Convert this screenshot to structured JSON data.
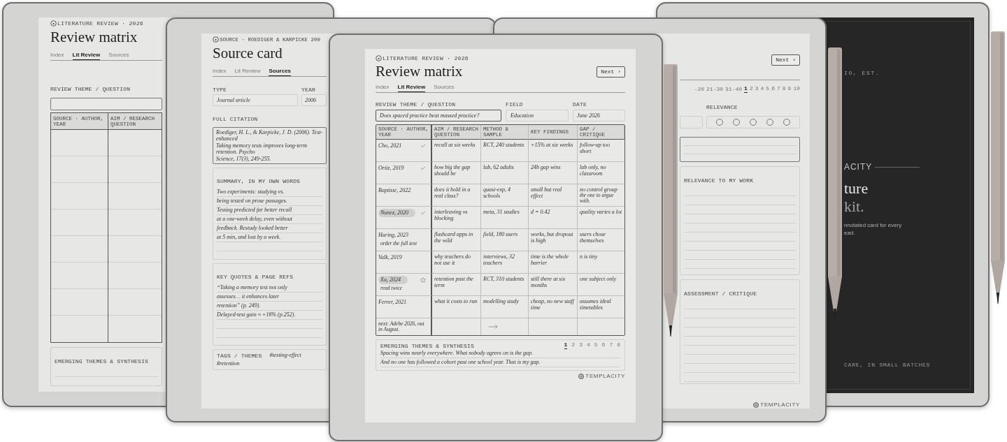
{
  "tablets": [
    {
      "kind": "matrix_outline",
      "eyebrow": "LITERATURE REVIEW · 2026",
      "title": "Review matrix",
      "tabs": [
        {
          "label": "Index",
          "selected": false
        },
        {
          "label": "Lit Review",
          "selected": true
        },
        {
          "label": "Sources",
          "selected": false
        }
      ],
      "theme_label": "REVIEW THEME / QUESTION",
      "columns": [
        "SOURCE · AUTHOR, YEAR",
        "AIM / RESEARCH QUESTION"
      ],
      "synthesis_label": "EMERGING THEMES & SYNTHESIS"
    },
    {
      "kind": "source_card",
      "eyebrow": "SOURCE · ROEDIGER & KARPICKE 200",
      "title": "Source card",
      "tabs": [
        {
          "label": "Index",
          "selected": false
        },
        {
          "label": "Lit Review",
          "selected": false
        },
        {
          "label": "Sources",
          "selected": true
        }
      ],
      "type_label": "TYPE",
      "type_value": "Journal article",
      "year_label": "YEAR",
      "year_value": "2006",
      "citation_label": "FULL CITATION",
      "citation_lines": [
        "Roediger, H. L., & Karpicke, J. D. (2006). Test-enhanced",
        "Taking memory tests improves long-term retention. Psycho",
        "Science, 17(3), 249-255."
      ],
      "summary_label": "SUMMARY, IN MY OWN WORDS",
      "summary_lines": [
        "Two experiments: studying vs.",
        "being tested on prose passages.",
        "Testing predicted far better recall",
        "at a one-week delay, even without",
        "feedback. Restudy looked better",
        "at 5 min, and lost by a week."
      ],
      "quotes_label": "KEY QUOTES & PAGE REFS",
      "quotes_lines": [
        "“Taking a memory test not only",
        "assesses… it enhances later",
        "retention” (p. 249).",
        "Delayed-test gain ≈ +18% (p.252)."
      ],
      "tags_label": "TAGS / THEMES",
      "tags": [
        "#testing-effect",
        "#retention"
      ]
    },
    {
      "kind": "matrix_filled",
      "eyebrow": "LITERATURE REVIEW · 2026",
      "title": "Review matrix",
      "next": "Next ›",
      "tabs": [
        {
          "label": "Index",
          "selected": false
        },
        {
          "label": "Lit Review",
          "selected": true
        },
        {
          "label": "Sources",
          "selected": false
        }
      ],
      "theme_label": "REVIEW THEME / QUESTION",
      "theme_value": "Does spaced practice beat massed practice?",
      "field_label": "FIELD",
      "field_value": "Education",
      "date_label": "DATE",
      "date_value": "June 2026",
      "columns": [
        "SOURCE · AUTHOR, YEAR",
        "AIM / RESEARCH QUESTION",
        "METHOD & SAMPLE",
        "KEY FINDINGS",
        "GAP / CRITIQUE"
      ],
      "rows": [
        {
          "source": "Cho, 2021",
          "highlighted": false,
          "checked": true,
          "starred": false,
          "aim": "recall at six weeks",
          "method": "RCT, 240 students",
          "findings": "+15% at six weeks",
          "gap": "follow-up too short"
        },
        {
          "source": "Ortiz, 2019",
          "highlighted": false,
          "checked": true,
          "starred": false,
          "aim": "how big the gap should be",
          "method": "lab, 62 adults",
          "findings": "24h gap wins",
          "gap": "lab only, no classroom"
        },
        {
          "source": "Baptiste, 2022",
          "highlighted": false,
          "checked": false,
          "starred": false,
          "aim": "does it hold in a real class?",
          "method": "quasi-exp, 4 schools",
          "findings": "small but real effect",
          "gap": "no control group",
          "gap_note": "the one to argue with."
        },
        {
          "source": "Nunez, 2020",
          "highlighted": true,
          "checked": true,
          "starred": false,
          "aim": "interleaving vs blocking",
          "method": "meta, 31 studies",
          "findings": "d = 0.42",
          "gap": "quality varies a lot"
        },
        {
          "source": "Haring, 2023",
          "note": "order the full text",
          "highlighted": false,
          "checked": false,
          "starred": false,
          "aim": "flashcard apps in the wild",
          "method": "field, 180 users",
          "findings": "works, but dropout is high",
          "gap": "users chose themselves"
        },
        {
          "source": "Valk, 2019",
          "highlighted": false,
          "checked": false,
          "starred": false,
          "aim": "why teachers do not use it",
          "method": "interviews, 32 teachers",
          "findings": "time is the whole barrier",
          "gap": "n is tiny"
        },
        {
          "source": "Xu, 2024",
          "note": "read twice",
          "highlighted": true,
          "checked": false,
          "starred": true,
          "aim": "retention past the term",
          "method": "RCT, 310 students",
          "findings": "still there at six months",
          "gap": "one subject only"
        },
        {
          "source": "Ferrer, 2021",
          "highlighted": false,
          "checked": false,
          "starred": false,
          "aim": "what it costs to run",
          "method": "modelling study",
          "findings": "cheap, no new staff time",
          "gap": "assumes ideal timetables"
        }
      ],
      "table_note": "next: Adebe 2026, out in August.",
      "synthesis_label": "EMERGING THEMES & SYNTHESIS",
      "pages": [
        {
          "label": "1",
          "selected": true
        },
        {
          "label": "2",
          "selected": false
        },
        {
          "label": "3",
          "selected": false
        },
        {
          "label": "4",
          "selected": false
        },
        {
          "label": "5",
          "selected": false
        },
        {
          "label": "6",
          "selected": false
        },
        {
          "label": "7",
          "selected": false
        },
        {
          "label": "8",
          "selected": false
        }
      ],
      "synthesis_lines": [
        "Spacing wins nearly everywhere. What nobody agrees on is the gap.",
        "And no one has followed a cohort past one school year. That is my gap."
      ],
      "brand": "TEMPLACITY"
    },
    {
      "kind": "source_detail",
      "next": "Next ›",
      "ranges": [
        "-20",
        "21-30",
        "31-40"
      ],
      "pages": [
        {
          "label": "1",
          "selected": true
        },
        {
          "label": "2",
          "selected": false
        },
        {
          "label": "3",
          "selected": false
        },
        {
          "label": "4",
          "selected": false
        },
        {
          "label": "5",
          "selected": false
        },
        {
          "label": "6",
          "selected": false
        },
        {
          "label": "7",
          "selected": false
        },
        {
          "label": "8",
          "selected": false
        },
        {
          "label": "9",
          "selected": false
        },
        {
          "label": "10",
          "selected": false
        }
      ],
      "relevance_label": "RELEVANCE",
      "stars": 0,
      "relevance_section": "RELEVANCE TO MY WORK",
      "assessment_section": "ASSESSMENT / CRITIQUE",
      "brand": "TEMPLACITY"
    },
    {
      "kind": "cover",
      "eyebrow": "IO, EST.",
      "brand": "ACITY",
      "title_lines": [
        "ture",
        "kit."
      ],
      "blurb_lines": [
        "nnotated card for every",
        "ead."
      ],
      "footer": "CARE, IN SMALL BATCHES"
    }
  ]
}
